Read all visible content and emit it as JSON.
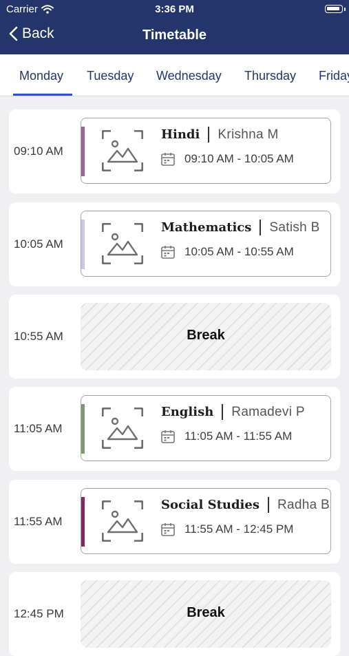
{
  "status_bar": {
    "carrier": "Carrier",
    "time": "3:36 PM"
  },
  "nav": {
    "back_label": "Back",
    "title": "Timetable"
  },
  "tabs": [
    {
      "label": "Monday",
      "selected": true
    },
    {
      "label": "Tuesday",
      "selected": false
    },
    {
      "label": "Wednesday",
      "selected": false
    },
    {
      "label": "Thursday",
      "selected": false
    },
    {
      "label": "Friday",
      "selected": false
    }
  ],
  "periods": [
    {
      "start": "09:10 AM",
      "type": "class",
      "subject": "Hindi",
      "teacher": "Krishna  M",
      "range": "09:10 AM - 10:05 AM",
      "accent": "#a0629e"
    },
    {
      "start": "10:05 AM",
      "type": "class",
      "subject": "Mathematics",
      "teacher": "Satish  B",
      "range": "10:05 AM - 10:55 AM",
      "accent": "#c9c9e6"
    },
    {
      "start": "10:55 AM",
      "type": "break",
      "label": "Break"
    },
    {
      "start": "11:05 AM",
      "type": "class",
      "subject": "English",
      "teacher": "Ramadevi  P",
      "range": "11:05 AM - 11:55 AM",
      "accent": "#7f9878"
    },
    {
      "start": "11:55 AM",
      "type": "class",
      "subject": "Social Studies",
      "teacher": "Radha  B",
      "range": "11:55 AM - 12:45 PM",
      "accent": "#7c2b63"
    },
    {
      "start": "12:45 PM",
      "type": "break",
      "label": "Break"
    }
  ],
  "colors": {
    "header": "#23356b",
    "tab_text": "#23356b",
    "tab_active": "#2d4fcf",
    "background": "#f0f0f2"
  },
  "icons": {
    "subject_placeholder": "image-placeholder-icon",
    "calendar": "calendar-icon",
    "wifi": "wifi-icon",
    "back": "chevron-left-icon",
    "battery": "battery-icon"
  }
}
